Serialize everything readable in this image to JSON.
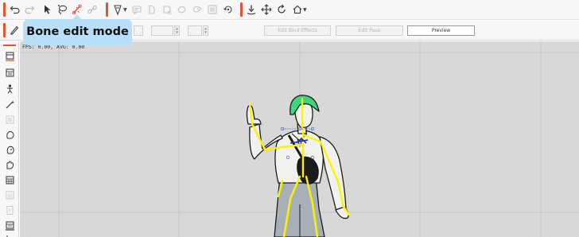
{
  "toolbar": {
    "icons": [
      "undo-icon",
      "redo-icon",
      "select-arrow-icon",
      "lasso-icon",
      "bone-edit-icon",
      "link-icon",
      "brush-dropdown-icon",
      "mesh-icon",
      "bone-tool-icon",
      "bind-icon",
      "weight-icon",
      "image-icon",
      "reset-icon",
      "pin-icon",
      "move-icon",
      "rotate-icon",
      "home-dropdown-icon"
    ]
  },
  "toolbar2": {
    "field1_value": "",
    "label_x": "",
    "field_x_value": "",
    "label_y": "",
    "field_y_value": "",
    "edit_bind_effects_label": "Edit Bind Effects",
    "edit_pose_label": "Edit Pose",
    "preview_label": "Preview"
  },
  "tooltip": {
    "text": "Bone edit mode"
  },
  "canvas": {
    "fps_text": "FPS: 0.00, AVG: 0.00",
    "background": "#d8d8d8",
    "grid_color": "#c6c6c6"
  },
  "colors": {
    "accent_red": "#e0572f",
    "bone_yellow": "#fff200",
    "selected_bone": "#1f2fd8",
    "hair_green": "#3ed67c",
    "tooltip_bg": "#b7dff8"
  }
}
